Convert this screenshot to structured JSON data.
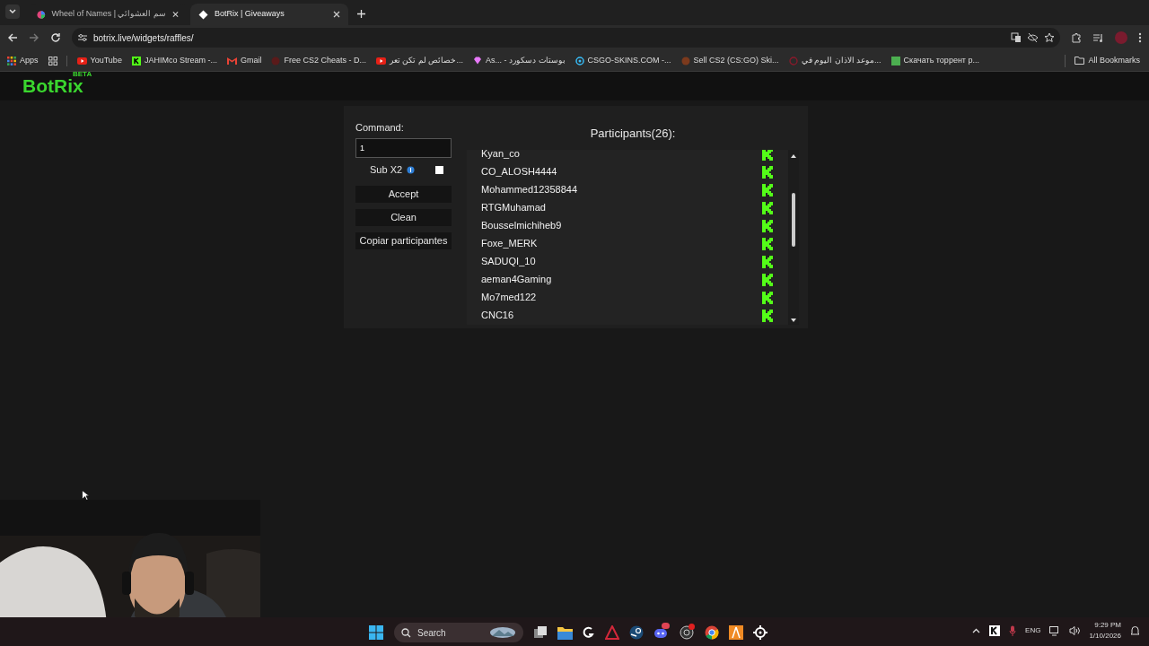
{
  "tabs": [
    {
      "title": "Wheel of Names | سم العشوائي",
      "selected": false
    },
    {
      "title": "BotRix | Giveaways",
      "selected": true
    }
  ],
  "address_bar": {
    "url": "botrix.live/widgets/raffles/"
  },
  "bookmarks": [
    "Apps",
    "YouTube",
    "JAHIMco Stream -...",
    "Gmail",
    "Free CS2 Cheats - D...",
    "خصائص لم تكن تعر...",
    "As... - بوستات دسكورد",
    "CSGO-SKINS.COM -...",
    "Sell CS2 (CS:GO) Ski...",
    "موعد الاذان اليوم في...",
    "Скачать торрент р..."
  ],
  "all_bookmarks": "All Bookmarks",
  "logo": {
    "name": "BotRix",
    "badge": "BETA"
  },
  "raffle": {
    "command_label": "Command:",
    "command_value": "1",
    "sub_x2": {
      "label": "Sub X2",
      "checked": false
    },
    "buttons": [
      "Accept",
      "Clean",
      "Copiar participantes"
    ],
    "participants_title": "Participants(26):",
    "participants": [
      "Kyan_co",
      "CO_ALOSH4444",
      "Mohammed12358844",
      "RTGMuhamad",
      "Bousselmichiheb9",
      "Foxe_MERK",
      "SADUQI_10",
      "aeman4Gaming",
      "Mo7med122",
      "CNC16"
    ]
  },
  "taskbar": {
    "search_placeholder": "Search",
    "tray": {
      "language": "ENG",
      "time": "9:29 PM",
      "date": "1/10/2026"
    }
  }
}
